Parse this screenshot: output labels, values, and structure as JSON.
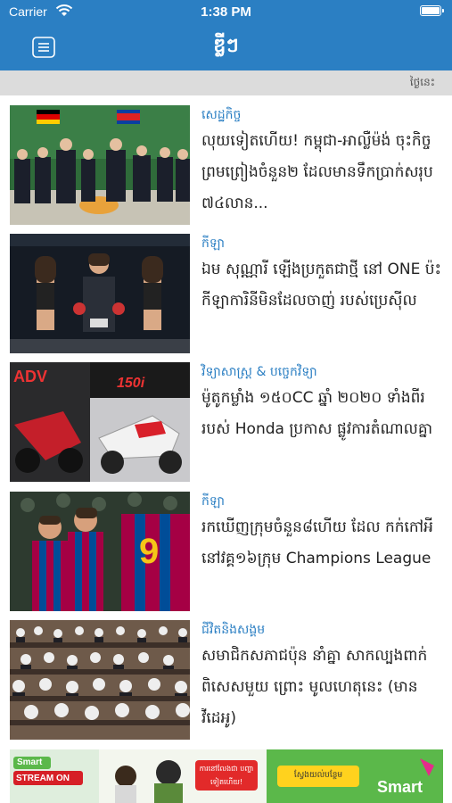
{
  "status_bar": {
    "carrier": "Carrier",
    "time": "1:38 PM"
  },
  "app": {
    "title": "ឌ្លីៗ"
  },
  "date_bar": {
    "label": "ថ្ងៃនេះ"
  },
  "articles": [
    {
      "category": "សេដ្ឋកិច្ច",
      "headline": "លុយទៀតហើយ! កម្ពុជា-អាល្លឺម៉ង់ ចុះកិច្ចព្រមព្រៀងចំនួន២ ដែលមានទឹកប្រាក់សរុប ៧៤លាន..."
    },
    {
      "category": "កីឡា",
      "headline": "ឯម សុណ្ណារី ឡើងប្រកួតជាថ្មី នៅ ONE ប៉ះកីឡាការិនីមិនដែលចាញ់ របស់ប្រេស៊ីល"
    },
    {
      "category": "វិទ្យាសាស្ត្រ & បច្ចេកវិទ្យា",
      "headline": "ម៉ូតូកម្លាំង ១៥០CC ឆ្នាំ ២០២០ ទាំងពីររបស់ Honda ប្រកាស ផ្លូវការតំណាលគ្នា"
    },
    {
      "category": "កីឡា",
      "headline": "រកឃើញក្រុមចំនួន៨ហើយ ដែល កក់កៅអីនៅវគ្គ១៦ក្រុម Champions League"
    },
    {
      "category": "ជីវិតនិងសង្គម",
      "headline": "សមាជិកសភាជប៉ុន នាំគ្នា សាកល្បងពាក់ពិសេសមួយ ព្រោះ មូលហេតុនេះ (មានវីដេអូ)"
    }
  ],
  "banner": {
    "brand_left": "Smart",
    "stream": "STREAM ON",
    "promo_text": "ការនៅលែងជា បញ្ហាទៀតហើយ!",
    "cta": "ស្វែងយល់បន្ថែម",
    "brand_right": "Smart"
  },
  "colors": {
    "accent": "#2b7fc3",
    "banner_green": "#5bb84a"
  }
}
